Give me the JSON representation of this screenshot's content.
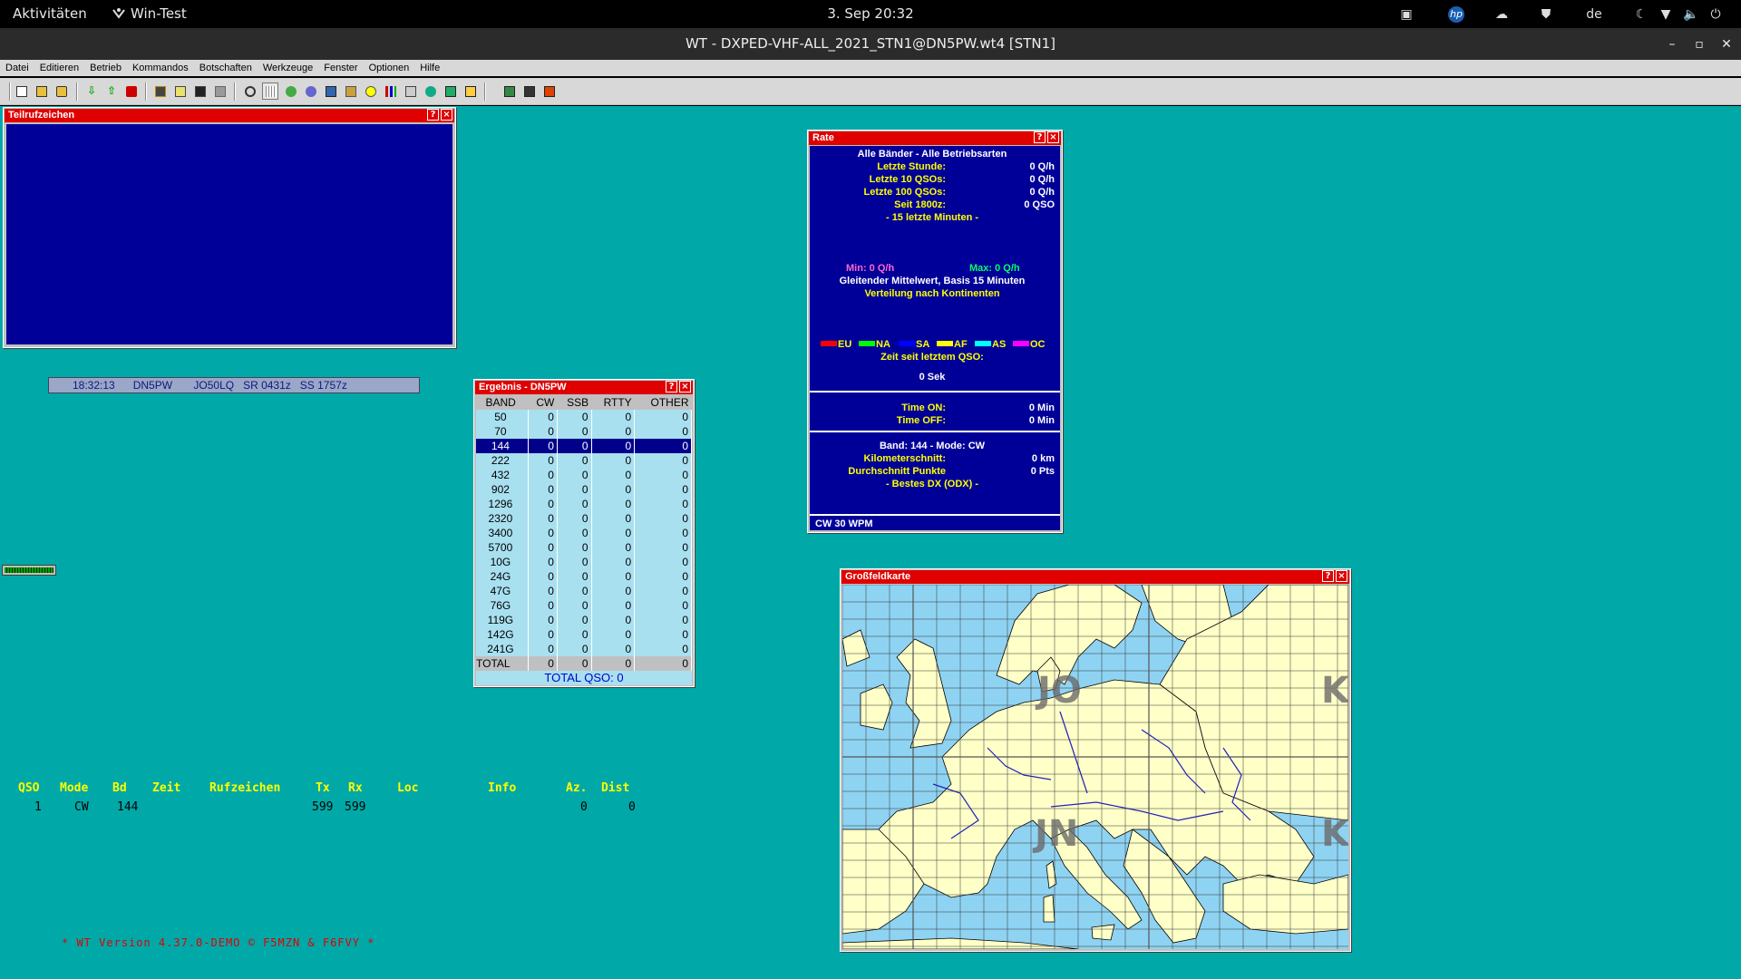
{
  "topbar": {
    "activities": "Aktivitäten",
    "app_name": "Win-Test",
    "clock": "3. Sep  20:32",
    "language": "de"
  },
  "window": {
    "title": "WT - DXPED-VHF-ALL_2021_STN1@DN5PW.wt4 [STN1]"
  },
  "menu": [
    "Datei",
    "Editieren",
    "Betrieb",
    "Kommandos",
    "Botschaften",
    "Werkzeuge",
    "Fenster",
    "Optionen",
    "Hilfe"
  ],
  "partial_window": {
    "title": "Teilrufzeichen"
  },
  "status_strip": "18:32:13      DN5PW       JO50LQ   SR 0431z   SS 1757z",
  "score": {
    "title": "Ergebnis - DN5PW",
    "columns": [
      "BAND",
      "CW",
      "SSB",
      "RTTY",
      "OTHER"
    ],
    "rows": [
      [
        "50",
        "0",
        "0",
        "0",
        "0"
      ],
      [
        "70",
        "0",
        "0",
        "0",
        "0"
      ],
      [
        "144",
        "0",
        "0",
        "0",
        "0"
      ],
      [
        "222",
        "0",
        "0",
        "0",
        "0"
      ],
      [
        "432",
        "0",
        "0",
        "0",
        "0"
      ],
      [
        "902",
        "0",
        "0",
        "0",
        "0"
      ],
      [
        "1296",
        "0",
        "0",
        "0",
        "0"
      ],
      [
        "2320",
        "0",
        "0",
        "0",
        "0"
      ],
      [
        "3400",
        "0",
        "0",
        "0",
        "0"
      ],
      [
        "5700",
        "0",
        "0",
        "0",
        "0"
      ],
      [
        "10G",
        "0",
        "0",
        "0",
        "0"
      ],
      [
        "24G",
        "0",
        "0",
        "0",
        "0"
      ],
      [
        "47G",
        "0",
        "0",
        "0",
        "0"
      ],
      [
        "76G",
        "0",
        "0",
        "0",
        "0"
      ],
      [
        "119G",
        "0",
        "0",
        "0",
        "0"
      ],
      [
        "142G",
        "0",
        "0",
        "0",
        "0"
      ],
      [
        "241G",
        "0",
        "0",
        "0",
        "0"
      ]
    ],
    "selected_band": "144",
    "total_row": [
      "TOTAL",
      "0",
      "0",
      "0",
      "0"
    ],
    "total_qso": "TOTAL QSO: 0"
  },
  "rate": {
    "title": "Rate",
    "header": "Alle Bänder - Alle Betriebsarten",
    "last_hour_label": "Letzte Stunde:",
    "last_hour_value": "0 Q/h",
    "last10_label": "Letzte 10 QSOs:",
    "last10_value": "0 Q/h",
    "last100_label": "Letzte 100 QSOs:",
    "last100_value": "0 Q/h",
    "since_label": "Seit 1800z:",
    "since_value": "0 QSO",
    "minutes": "- 15 letzte Minuten -",
    "min": "Min: 0 Q/h",
    "max": "Max: 0 Q/h",
    "moving_avg": "Gleitender Mittelwert, Basis 15 Minuten",
    "distribution": "Verteilung nach Kontinenten",
    "continents": [
      {
        "label": "EU",
        "color": "#ff0000"
      },
      {
        "label": "NA",
        "color": "#00ff00"
      },
      {
        "label": "SA",
        "color": "#0000ff"
      },
      {
        "label": "AF",
        "color": "#ffff00"
      },
      {
        "label": "AS",
        "color": "#00ffff"
      },
      {
        "label": "OC",
        "color": "#ff00ff"
      }
    ],
    "since_last_label": "Zeit seit letztem QSO:",
    "since_last_value": "0 Sek",
    "time_on_label": "Time ON:",
    "time_on_value": "0 Min",
    "time_off_label": "Time OFF:",
    "time_off_value": "0 Min",
    "band_mode": "Band: 144 - Mode: CW",
    "km_label": "Kilometerschnitt:",
    "km_value": "0 km",
    "pts_label": "Durchschnitt Punkte",
    "pts_value": "0 Pts",
    "odx": "- Bestes DX (ODX) -",
    "footer": "CW  30 WPM"
  },
  "map": {
    "title": "Großfeldkarte",
    "labels": [
      "JO",
      "JN",
      "K",
      "K"
    ]
  },
  "log": {
    "headers": [
      "QSO",
      "Mode",
      "Bd",
      "Zeit",
      "Rufzeichen",
      "Tx",
      "Rx",
      "Loc",
      "Info",
      "Az.",
      "Dist"
    ],
    "row": [
      "1",
      "CW",
      "144",
      "",
      "",
      "599",
      "599",
      "",
      "",
      "0",
      "0"
    ]
  },
  "version": "* WT Version 4.37.0-DEMO © F5MZN & F6FVY *",
  "colors": {
    "workspace": "#00a8a8",
    "window_title": "#e00000",
    "panel_blue": "#000099",
    "rate_text": "#ffff00"
  }
}
